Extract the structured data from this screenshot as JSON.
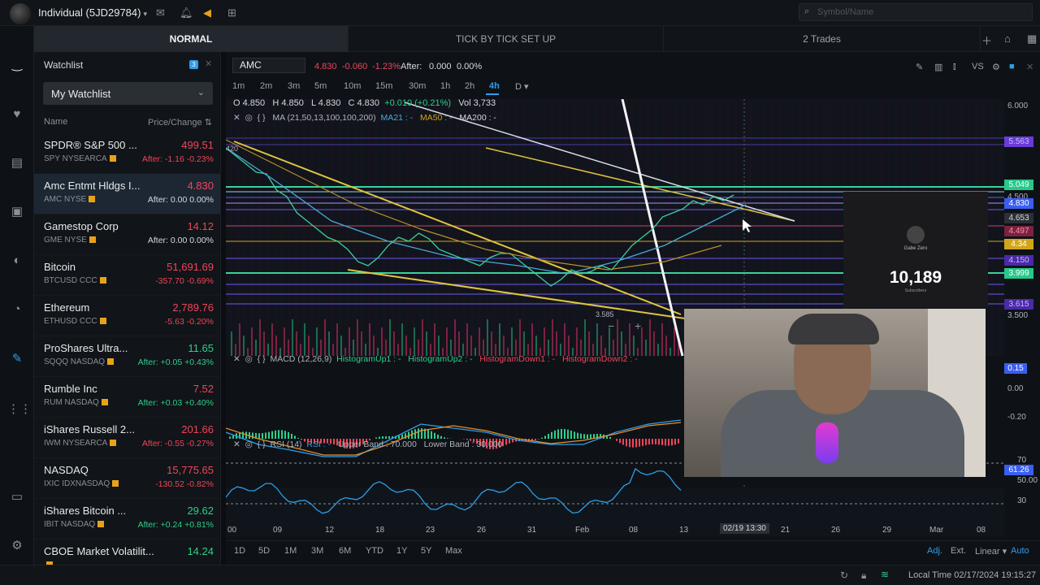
{
  "topbar": {
    "account": "Individual (5JD29784)",
    "search_placeholder": "Symbol/Name",
    "icons": [
      "mail-icon",
      "bell-icon",
      "megaphone-icon",
      "plus-square-icon"
    ]
  },
  "tabs": [
    {
      "label": "NORMAL"
    },
    {
      "label": "TICK BY TICK SET UP"
    },
    {
      "label": "2 Trades"
    }
  ],
  "watchlist": {
    "title": "Watchlist",
    "badge": "3",
    "selected_list": "My Watchlist",
    "col_name": "Name",
    "col_price": "Price/Change",
    "items": [
      {
        "name": "SPDR® S&P 500 ...",
        "symbol": "SPY NYSEARCA",
        "price": "499.51",
        "change": "After: -1.16 -0.23%",
        "price_color": "#f0455a",
        "change_color": "#f0455a"
      },
      {
        "name": "Amc Entmt Hldgs I...",
        "symbol": "AMC NYSE",
        "price": "4.830",
        "change": "After: 0.00 0.00%",
        "price_color": "#f0455a",
        "change_color": "#d6d9de"
      },
      {
        "name": "Gamestop Corp",
        "symbol": "GME NYSE",
        "price": "14.12",
        "change": "After: 0.00 0.00%",
        "price_color": "#f0455a",
        "change_color": "#d6d9de"
      },
      {
        "name": "Bitcoin",
        "symbol": "BTCUSD CCC",
        "price": "51,691.69",
        "change": "-357.70 -0.69%",
        "price_color": "#f0455a",
        "change_color": "#f0455a"
      },
      {
        "name": "Ethereum",
        "symbol": "ETHUSD CCC",
        "price": "2,789.76",
        "change": "-5.63 -0.20%",
        "price_color": "#f0455a",
        "change_color": "#f0455a"
      },
      {
        "name": "ProShares Ultra...",
        "symbol": "SQQQ NASDAQ",
        "price": "11.65",
        "change": "After: +0.05 +0.43%",
        "price_color": "#2fce8a",
        "change_color": "#2fce8a"
      },
      {
        "name": "Rumble Inc",
        "symbol": "RUM NASDAQ",
        "price": "7.52",
        "change": "After: +0.03 +0.40%",
        "price_color": "#f0455a",
        "change_color": "#2fce8a"
      },
      {
        "name": "iShares Russell 2...",
        "symbol": "IWM NYSEARCA",
        "price": "201.66",
        "change": "After: -0.55 -0.27%",
        "price_color": "#f0455a",
        "change_color": "#f0455a"
      },
      {
        "name": "NASDAQ",
        "symbol": "IXIC IDXNASDAQ",
        "price": "15,775.65",
        "change": "-130.52 -0.82%",
        "price_color": "#f0455a",
        "change_color": "#f0455a"
      },
      {
        "name": "iShares Bitcoin ...",
        "symbol": "IBIT NASDAQ",
        "price": "29.62",
        "change": "After: +0.24 +0.81%",
        "price_color": "#2fce8a",
        "change_color": "#2fce8a"
      },
      {
        "name": "CBOE Market Volatilit...",
        "symbol": "",
        "price": "14.24",
        "change": "",
        "price_color": "#2fce8a",
        "change_color": "#2fce8a"
      }
    ]
  },
  "chart": {
    "symbol": "AMC",
    "last": "4.830",
    "change": "-0.060",
    "change_pct": "-1.23%",
    "after_label": "After:",
    "after_value": "0.000",
    "after_pct": "0.00%",
    "intervals": [
      "1m",
      "2m",
      "3m",
      "5m",
      "10m",
      "15m",
      "30m",
      "1h",
      "2h",
      "4h",
      "D ▾"
    ],
    "active_interval": "4h",
    "ohlc": {
      "o": "O 4.850",
      "h": "H 4.850",
      "l": "L 4.830",
      "c": "C 4.830",
      "chg": "+0.010 (+0.21%)",
      "vol": "Vol 3,733"
    },
    "ma_label": "MA (21,50,13,100,100,200)",
    "ma21": "MA21 : -",
    "ma50": "MA50 : -",
    "ma200": "MA200 : -",
    "macd_label": "MACD (12,26,9)",
    "hist_up1": "HistogramUp1 : -",
    "hist_up2": "HistogramUp2 : -",
    "hist_down1": "HistogramDown1 : -",
    "hist_down2": "HistogramDown2 : -",
    "rsi_label": "RSI (14)",
    "rsi_val": "RSI : -",
    "rsi_upper": "Upper Band : 70.000",
    "rsi_lower": "Lower Band : 30.000",
    "price_axis": [
      "6.000",
      "4.500",
      "3.500"
    ],
    "price_chips": [
      {
        "label": "5.563",
        "color": "#6a3bd6",
        "text": "#c9b9ff"
      },
      {
        "label": "5.049",
        "color": "#27c88a",
        "text": "#ffffff"
      },
      {
        "label": "4.830",
        "color": "#3a5ef0",
        "text": "#ffffff"
      },
      {
        "label": "4.653",
        "color": "#2b2f36",
        "text": "#d6d9de"
      },
      {
        "label": "4.497",
        "color": "#7a2340",
        "text": "#ff8fa8"
      },
      {
        "label": "4.34",
        "color": "#d1a51a",
        "text": "#ffffff"
      },
      {
        "label": "4.150",
        "color": "#4a2aa6",
        "text": "#c9b9ff"
      },
      {
        "label": "3.999",
        "color": "#27c88a",
        "text": "#ffffff"
      },
      {
        "label": "3.615",
        "color": "#4a2aa6",
        "text": "#c9b9ff"
      }
    ],
    "macd_axis": [
      "0.15",
      "0.00",
      "-0.20"
    ],
    "rsi_axis": [
      "70",
      "61.26",
      "50.00",
      "30"
    ],
    "x_axis": [
      "00",
      "09",
      "12",
      "18",
      "23",
      "26",
      "31",
      "Feb",
      "08",
      "13",
      "02/19 13:30",
      "21",
      "26",
      "29",
      "Mar",
      "08"
    ],
    "low_marker": "3.585",
    "timeframes": [
      "1D",
      "5D",
      "1M",
      "3M",
      "6M",
      "YTD",
      "1Y",
      "5Y",
      "Max"
    ],
    "adj": "Adj.",
    "ext": "Ext.",
    "scale": "Linear ▾",
    "auto": "Auto"
  },
  "overlay": {
    "count": "10,189",
    "name": "Gabe Zero",
    "sub": "Subscribers"
  },
  "status": {
    "local_time": "Local Time 02/17/2024 19:15:27"
  }
}
